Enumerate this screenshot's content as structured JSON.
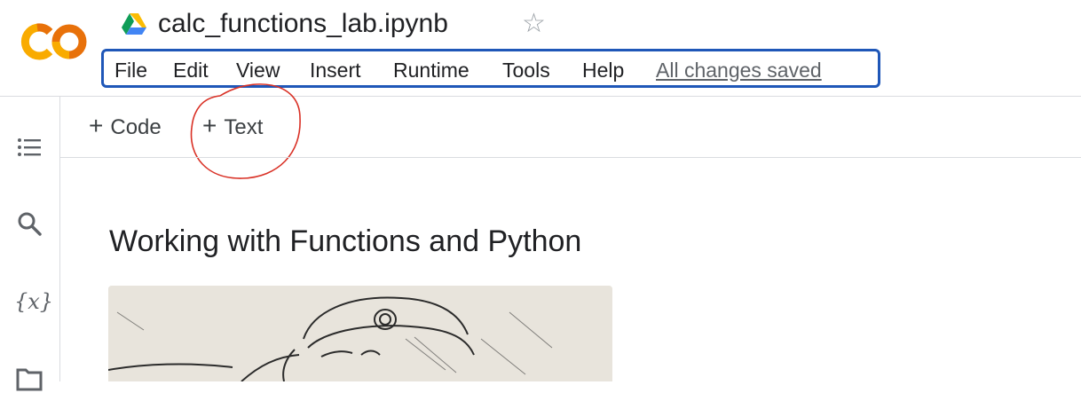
{
  "app": {
    "logo": "colab-logo"
  },
  "header": {
    "drive_icon": "google-drive-icon",
    "notebook_title": "calc_functions_lab.ipynb",
    "star_icon": "star-outline-icon"
  },
  "menu": {
    "items": [
      "File",
      "Edit",
      "View",
      "Insert",
      "Runtime",
      "Tools",
      "Help"
    ],
    "status": "All changes saved",
    "highlight_color": "#1f57b8"
  },
  "sidebar": {
    "icons": [
      "table-of-contents-icon",
      "search-icon",
      "variables-icon",
      "files-icon"
    ],
    "variables_glyph": "{x}"
  },
  "toolbar": {
    "add_code": "Code",
    "add_text": "Text",
    "annotation_color": "#d93025"
  },
  "content": {
    "heading": "Working with Functions and Python",
    "image": "engraving-illustration"
  }
}
